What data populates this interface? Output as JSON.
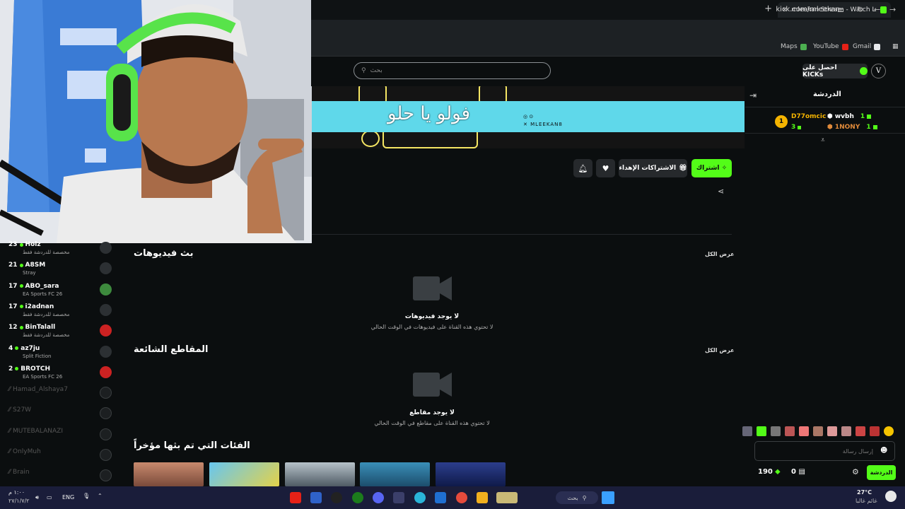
{
  "browser": {
    "tab_title": "mleekan Stream - Watch Live o",
    "new_tab": "+",
    "close_tab": "×",
    "url": "kick.com/mleekan",
    "bookmarks": [
      "Maps",
      "YouTube",
      "Gmail"
    ]
  },
  "header": {
    "search_placeholder": "بحث",
    "get_kicks": "احصل على KICKs",
    "avatar_letter": "V"
  },
  "banner": {
    "text": "فولو يا حلو",
    "handle": "MLEEKAN8"
  },
  "actions": {
    "subscribe": "اشتراك",
    "gift_subs": "الاشتراكات الإهداء"
  },
  "sections": {
    "videos_title": "بث فيديوهات",
    "videos_see_all": "عرض الكل",
    "videos_empty_title": "لا يوجد فيديوهات",
    "videos_empty_sub": "لا تحتوي هذه القناة على فيديوهات في الوقت الحالي",
    "clips_title": "المقاطع الشائعة",
    "clips_see_all": "عرض الكل",
    "clips_empty_title": "لا يوجد مقاطع",
    "clips_empty_sub": "لا تحتوي هذه القناة على مقاطع في الوقت الحالي",
    "recent_title": "الفئات التي تم بثها مؤخراً"
  },
  "sidebar": {
    "channels": [
      {
        "count": "23",
        "name": "Holz",
        "category": "مخصصة للدردشة فقط",
        "live": true
      },
      {
        "count": "21",
        "name": "A8SM",
        "category": "Stray",
        "live": true
      },
      {
        "count": "17",
        "name": "ABO_sara",
        "category": "EA Sports FC 26",
        "live": true
      },
      {
        "count": "17",
        "name": "i2adnan",
        "category": "مخصصة للدردشة فقط",
        "live": true
      },
      {
        "count": "12",
        "name": "BinTalall",
        "category": "مخصصة للدردشة فقط",
        "live": true
      },
      {
        "count": "4",
        "name": "az7ju",
        "category": "Split Fiction",
        "live": true
      },
      {
        "count": "2",
        "name": "BROTCH",
        "category": "EA Sports FC 26",
        "live": true
      },
      {
        "count": "",
        "name": "Hamad_Alshaya7",
        "category": "",
        "live": false
      },
      {
        "count": "",
        "name": "S27W",
        "category": "",
        "live": false
      },
      {
        "count": "",
        "name": "MUTEBALANAZI",
        "category": "",
        "live": false
      },
      {
        "count": "",
        "name": "OnlyMuh",
        "category": "",
        "live": false
      },
      {
        "count": "",
        "name": "Brain",
        "category": "",
        "live": false
      }
    ]
  },
  "chat": {
    "title": "الدردشة",
    "gifters": [
      {
        "name": "D77omcic",
        "count": "3"
      },
      {
        "name": "wvbh",
        "count": "1"
      },
      {
        "name": "1NONY",
        "count": "1"
      }
    ],
    "input_placeholder": "إرسال رسالة",
    "send_label": "الدردشة",
    "balance_kicks": "190",
    "balance_other": "0"
  },
  "taskbar": {
    "time": "١:٠٠ م",
    "date": "٢٧/١/٧/٢",
    "lang": "ENG",
    "search": "بحث",
    "weather_temp": "27°C",
    "weather_desc": "غائم غالبا"
  },
  "colors": {
    "accent": "#53fc18",
    "background": "#0b0e0f",
    "banner": "#5fd8ea",
    "taskbar": "#1a1d3a"
  }
}
